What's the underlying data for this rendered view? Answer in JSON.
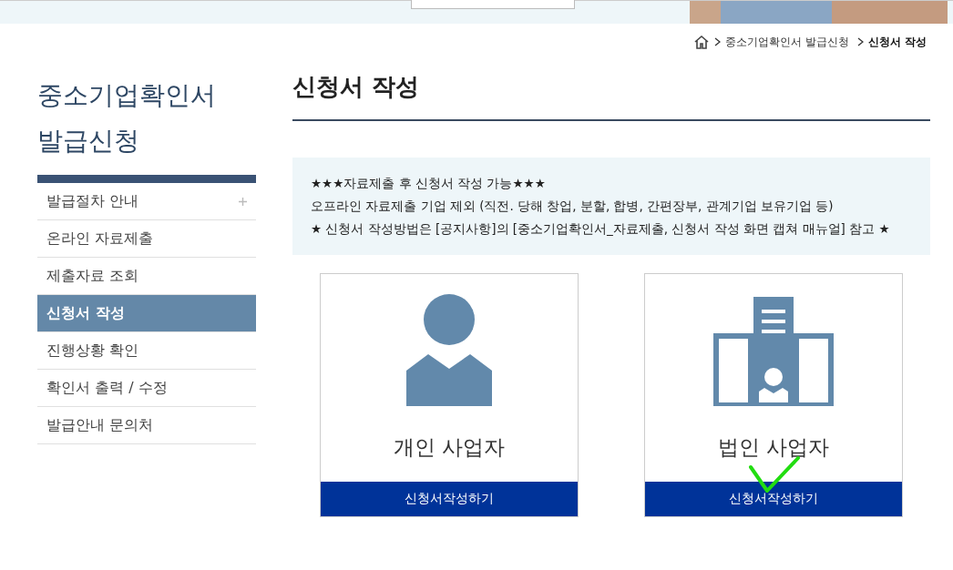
{
  "breadcrumb": [
    "중소기업확인서 발급신청",
    "신청서 작성"
  ],
  "sidebar": {
    "title": "중소기업확인서 발급신청",
    "items": [
      {
        "label": "발급절차 안내",
        "selected": false,
        "expandable": true
      },
      {
        "label": "온라인 자료제출",
        "selected": false,
        "expandable": false
      },
      {
        "label": "제출자료 조회",
        "selected": false,
        "expandable": false
      },
      {
        "label": "신청서 작성",
        "selected": true,
        "expandable": false
      },
      {
        "label": "진행상황 확인",
        "selected": false,
        "expandable": false
      },
      {
        "label": "확인서 출력 / 수정",
        "selected": false,
        "expandable": false
      },
      {
        "label": "발급안내 문의처",
        "selected": false,
        "expandable": false
      }
    ]
  },
  "page_title": "신청서 작성",
  "notice": [
    "★★★자료제출 후 신청서 작성 가능★★★",
    "오프라인 자료제출 기업 제외 (직전. 당해 창업, 분할, 합병, 간편장부, 관계기업 보유기업 등)",
    "★ 신청서 작성방법은 [공지사항]의 [중소기업확인서_자료제출, 신청서 작성 화면 캡쳐 매뉴얼] 참고 ★"
  ],
  "cards": [
    {
      "kind": "person",
      "label": "개인 사업자",
      "button": "신청서작성하기",
      "checked": false
    },
    {
      "kind": "building",
      "label": "법인 사업자",
      "button": "신청서작성하기",
      "checked": true
    }
  ]
}
